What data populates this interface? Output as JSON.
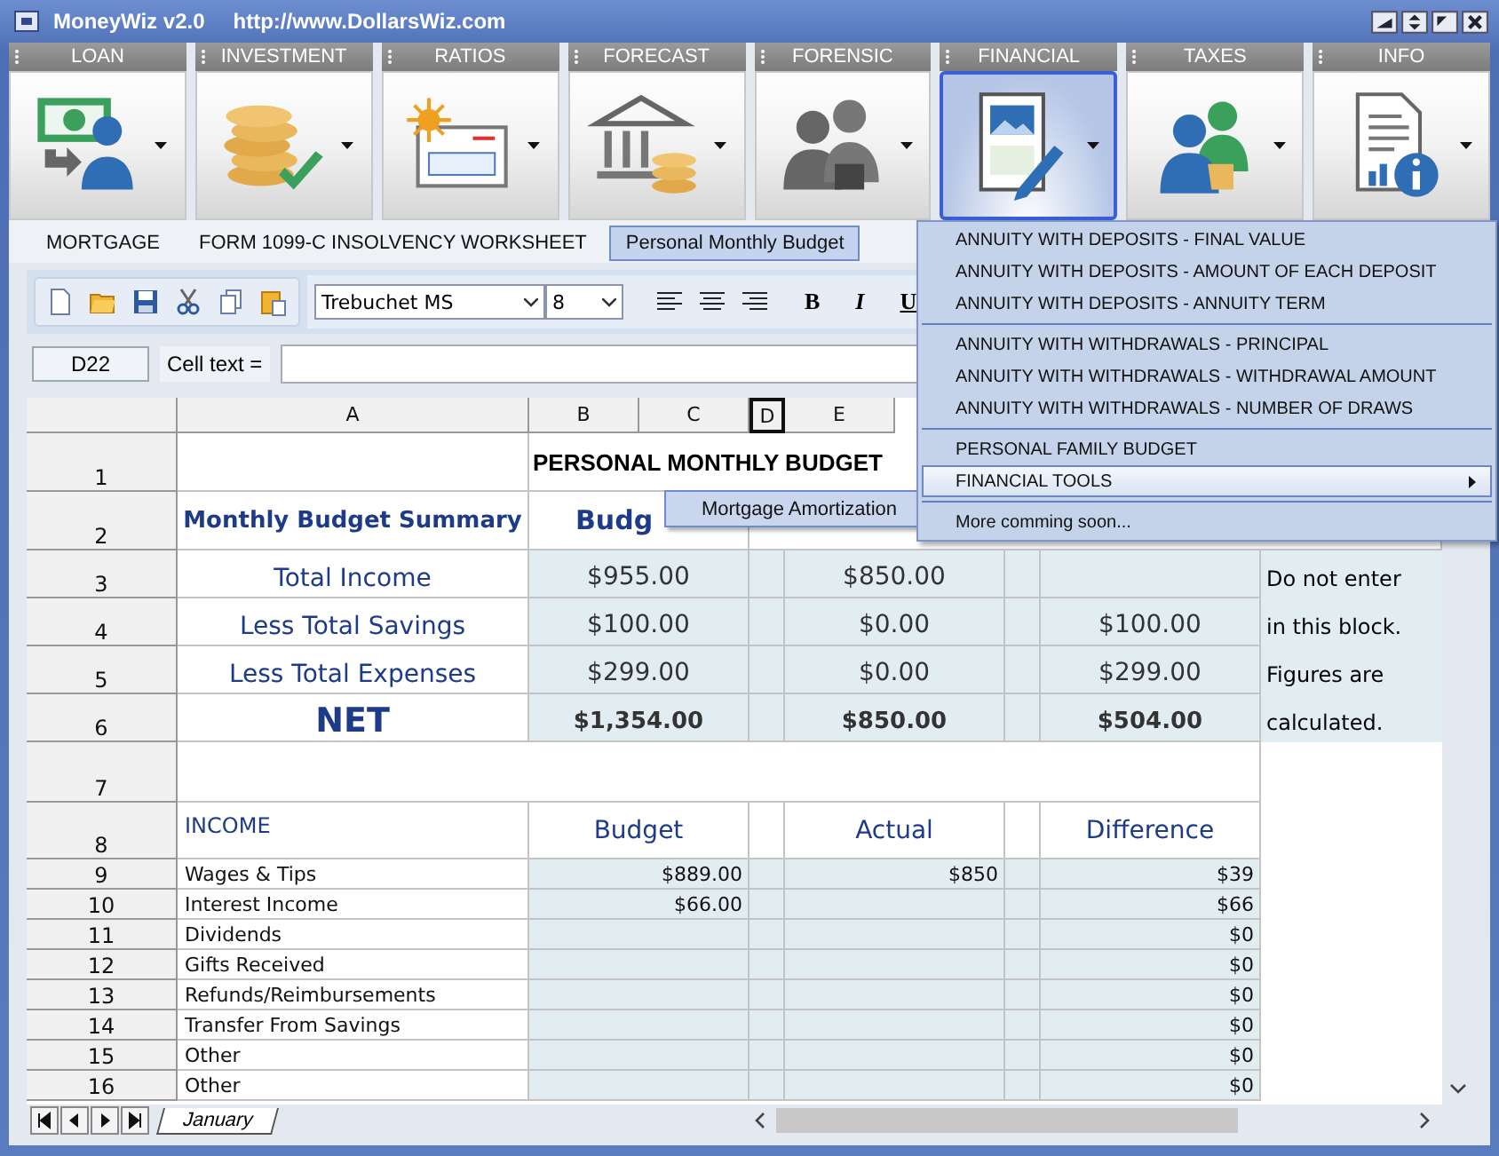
{
  "window": {
    "title": "MoneyWiz v2.0",
    "url": "http://www.DollarsWiz.com"
  },
  "ribbon": [
    {
      "label": "LOAN",
      "kind": "loan",
      "selected": false
    },
    {
      "label": "INVESTMENT",
      "kind": "investment",
      "selected": false
    },
    {
      "label": "RATIOS",
      "kind": "ratios",
      "selected": false
    },
    {
      "label": "FORECAST",
      "kind": "forecast",
      "selected": false
    },
    {
      "label": "FORENSIC",
      "kind": "forensic",
      "selected": false
    },
    {
      "label": "FINANCIAL",
      "kind": "financial",
      "selected": true
    },
    {
      "label": "TAXES",
      "kind": "taxes",
      "selected": false
    },
    {
      "label": "INFO",
      "kind": "info",
      "selected": false
    }
  ],
  "tabs": [
    {
      "label": "MORTGAGE",
      "selected": false
    },
    {
      "label": "FORM 1099-C INSOLVENCY WORKSHEET",
      "selected": false
    },
    {
      "label": "Personal Monthly Budget",
      "selected": true
    }
  ],
  "toolbar": {
    "font": "Trebuchet MS",
    "size": "8",
    "format_buttons": [
      "B",
      "I",
      "U"
    ]
  },
  "formula_bar": {
    "cell": "D22",
    "label": "Cell text ="
  },
  "sheet": {
    "columns": [
      {
        "label": "A",
        "selected": false
      },
      {
        "label": "B",
        "selected": false
      },
      {
        "label": "C",
        "selected": false
      },
      {
        "label": "D",
        "selected": true
      },
      {
        "label": "E",
        "selected": false
      }
    ],
    "title_row": {
      "number": "1",
      "title": "PERSONAL MONTHLY BUDGET"
    },
    "summary_header": {
      "number": "2",
      "label": "Monthly Budget Summary",
      "budget": "Budg"
    },
    "summary_rows": [
      {
        "number": "3",
        "kind": "normal",
        "label": "Total Income",
        "budget": "$955.00",
        "actual": "$850.00",
        "note": "Do not enter"
      },
      {
        "number": "4",
        "kind": "normal",
        "label": "Less Total Savings",
        "budget": "$100.00",
        "actual": "$0.00",
        "difference": "$100.00",
        "note": "in this block."
      },
      {
        "number": "5",
        "kind": "normal",
        "label": "Less Total Expenses",
        "budget": "$299.00",
        "actual": "$0.00",
        "difference": "$299.00",
        "note": "Figures are"
      },
      {
        "number": "6",
        "kind": "net",
        "label": "NET",
        "budget": "$1,354.00",
        "actual": "$850.00",
        "difference": "$504.00",
        "note": "calculated."
      }
    ],
    "blank_row": {
      "number": "7"
    },
    "income_header": {
      "number": "8",
      "label": "INCOME",
      "budget": "Budget",
      "actual": "Actual",
      "difference": "Difference"
    },
    "income_rows": [
      {
        "number": "9",
        "label": "Wages & Tips",
        "budget": "$889.00",
        "actual": "$850",
        "difference": "$39"
      },
      {
        "number": "10",
        "label": "Interest Income",
        "budget": "$66.00",
        "difference": "$66"
      },
      {
        "number": "11",
        "label": "Dividends",
        "difference": "$0"
      },
      {
        "number": "12",
        "label": "Gifts Received",
        "difference": "$0"
      },
      {
        "number": "13",
        "label": "Refunds/Reimbursements",
        "difference": "$0"
      },
      {
        "number": "14",
        "label": "Transfer From Savings",
        "difference": "$0"
      },
      {
        "number": "15",
        "label": "Other",
        "difference": "$0"
      },
      {
        "number": "16",
        "label": "Other",
        "difference": "$0"
      }
    ]
  },
  "sheet_tabs": [
    {
      "label": "January",
      "selected": true
    }
  ],
  "tooltip": "Mortgage Amortization",
  "menu": {
    "groups": [
      [
        {
          "label": "ANNUITY WITH DEPOSITS - FINAL VALUE",
          "selected": false,
          "submenu": false
        },
        {
          "label": "ANNUITY WITH DEPOSITS - AMOUNT OF EACH DEPOSIT",
          "selected": false,
          "submenu": false
        },
        {
          "label": "ANNUITY WITH DEPOSITS - ANNUITY TERM",
          "selected": false,
          "submenu": false
        }
      ],
      [
        {
          "label": "ANNUITY WITH WITHDRAWALS - PRINCIPAL",
          "selected": false,
          "submenu": false
        },
        {
          "label": "ANNUITY WITH WITHDRAWALS - WITHDRAWAL AMOUNT",
          "selected": false,
          "submenu": false
        },
        {
          "label": "ANNUITY WITH WITHDRAWALS - NUMBER OF DRAWS",
          "selected": false,
          "submenu": false
        }
      ],
      [
        {
          "label": "PERSONAL FAMILY BUDGET",
          "selected": false,
          "submenu": false
        },
        {
          "label": "FINANCIAL TOOLS",
          "selected": true,
          "submenu": true
        }
      ],
      [
        {
          "label": "More comming soon...",
          "selected": false,
          "submenu": false
        }
      ]
    ]
  }
}
